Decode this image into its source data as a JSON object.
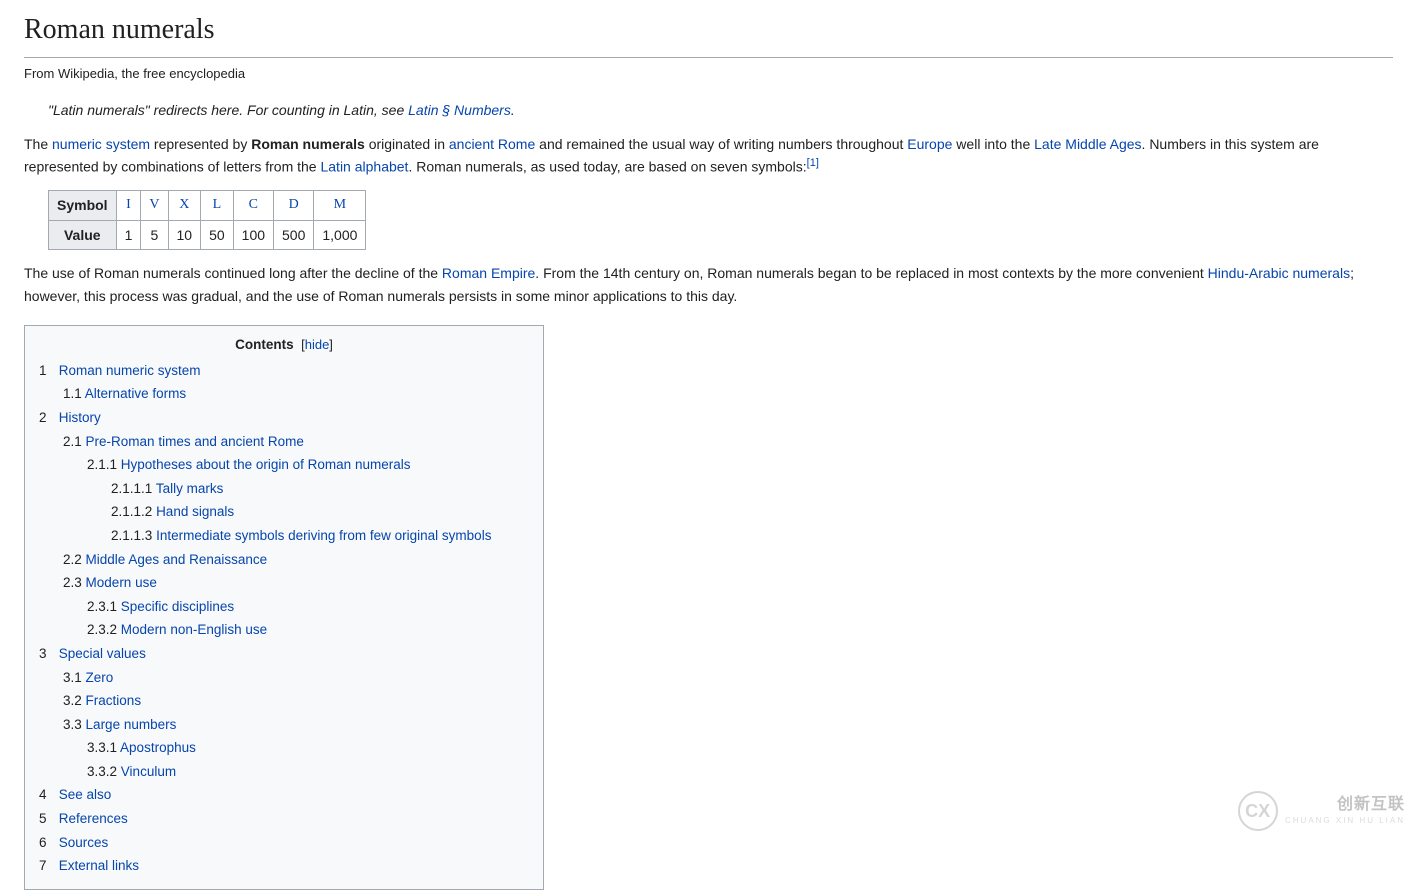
{
  "page_title": "Roman numerals",
  "subtitle": "From Wikipedia, the free encyclopedia",
  "hatnote": {
    "prefix": "\"Latin numerals\" redirects here. For counting in Latin, see ",
    "link": "Latin § Numbers",
    "suffix": "."
  },
  "para1": {
    "t1": "The ",
    "l1": "numeric system",
    "t2": " represented by ",
    "b1": "Roman numerals",
    "t3": " originated in ",
    "l2": "ancient Rome",
    "t4": " and remained the usual way of writing numbers throughout ",
    "l3": "Europe",
    "t5": " well into the ",
    "l4": "Late Middle Ages",
    "t6": ". Numbers in this system are represented by combinations of letters from the ",
    "l5": "Latin alphabet",
    "t7": ". Roman numerals, as used today, are based on seven symbols:",
    "ref": "[1]"
  },
  "symbols_table": {
    "row1_label": "Symbol",
    "row2_label": "Value",
    "symbols": [
      "I",
      "V",
      "X",
      "L",
      "C",
      "D",
      "M"
    ],
    "values": [
      "1",
      "5",
      "10",
      "50",
      "100",
      "500",
      "1,000"
    ]
  },
  "para2": {
    "t1": "The use of Roman numerals continued long after the decline of the ",
    "l1": "Roman Empire",
    "t2": ". From the 14th century on, Roman numerals began to be replaced in most contexts by the more convenient ",
    "l2": "Hindu-Arabic numerals",
    "t3": "; however, this process was gradual, and the use of Roman numerals persists in some minor applications to this day."
  },
  "toc": {
    "title": "Contents",
    "hide": "hide",
    "items": [
      {
        "num": "1",
        "text": "Roman numeric system",
        "children": [
          {
            "num": "1.1",
            "text": "Alternative forms"
          }
        ]
      },
      {
        "num": "2",
        "text": "History",
        "children": [
          {
            "num": "2.1",
            "text": "Pre-Roman times and ancient Rome",
            "children": [
              {
                "num": "2.1.1",
                "text": "Hypotheses about the origin of Roman numerals",
                "children": [
                  {
                    "num": "2.1.1.1",
                    "text": "Tally marks"
                  },
                  {
                    "num": "2.1.1.2",
                    "text": "Hand signals"
                  },
                  {
                    "num": "2.1.1.3",
                    "text": "Intermediate symbols deriving from few original symbols"
                  }
                ]
              }
            ]
          },
          {
            "num": "2.2",
            "text": "Middle Ages and Renaissance"
          },
          {
            "num": "2.3",
            "text": "Modern use",
            "children": [
              {
                "num": "2.3.1",
                "text": "Specific disciplines"
              },
              {
                "num": "2.3.2",
                "text": "Modern non-English use"
              }
            ]
          }
        ]
      },
      {
        "num": "3",
        "text": "Special values",
        "children": [
          {
            "num": "3.1",
            "text": "Zero"
          },
          {
            "num": "3.2",
            "text": "Fractions"
          },
          {
            "num": "3.3",
            "text": "Large numbers",
            "children": [
              {
                "num": "3.3.1",
                "text": "Apostrophus"
              },
              {
                "num": "3.3.2",
                "text": "Vinculum"
              }
            ]
          }
        ]
      },
      {
        "num": "4",
        "text": "See also"
      },
      {
        "num": "5",
        "text": "References"
      },
      {
        "num": "6",
        "text": "Sources"
      },
      {
        "num": "7",
        "text": "External links"
      }
    ]
  },
  "watermark": {
    "logo_text": "CX",
    "main": "创新互联",
    "sub": "CHUANG XIN HU LIAN"
  }
}
